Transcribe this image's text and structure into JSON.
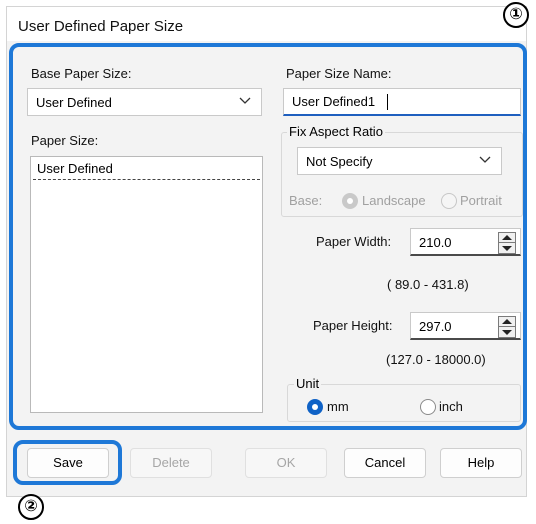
{
  "window": {
    "title": "User Defined Paper Size"
  },
  "callouts": {
    "one": "①",
    "two": "②"
  },
  "colors": {
    "highlight": "#1e78d7",
    "accent": "#0f62c6"
  },
  "base_paper_size": {
    "label": "Base Paper Size:",
    "value": "User Defined"
  },
  "paper_size": {
    "label": "Paper Size:",
    "items": [
      "User Defined"
    ]
  },
  "paper_size_name": {
    "label": "Paper Size Name:",
    "value": "User Defined1"
  },
  "fix_aspect_ratio": {
    "label": "Fix Aspect Ratio",
    "value": "Not Specify",
    "base_label": "Base:",
    "landscape": "Landscape",
    "portrait": "Portrait"
  },
  "paper_width": {
    "label": "Paper Width:",
    "value": "210.0",
    "range": "( 89.0 - 431.8)"
  },
  "paper_height": {
    "label": "Paper Height:",
    "value": "297.0",
    "range": "(127.0 - 18000.0)"
  },
  "unit": {
    "label": "Unit",
    "mm": "mm",
    "inch": "inch",
    "selected": "mm"
  },
  "buttons": {
    "save": "Save",
    "delete": "Delete",
    "ok": "OK",
    "cancel": "Cancel",
    "help": "Help"
  }
}
